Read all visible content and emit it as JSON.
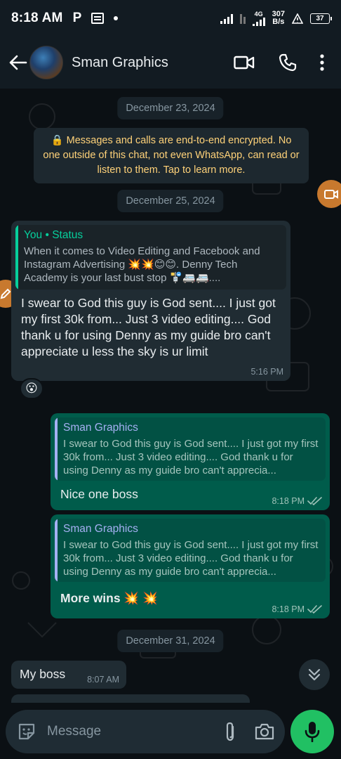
{
  "status_bar": {
    "time": "8:18 AM",
    "net_speed_value": "307",
    "net_speed_unit": "B/s",
    "network_type": "4G",
    "battery": "37"
  },
  "header": {
    "contact_name": "Sman Graphics",
    "icons": [
      "back-arrow-icon",
      "video-call-icon",
      "phone-icon",
      "more-vert-icon"
    ]
  },
  "chat": {
    "dates": {
      "d1": "December 23, 2024",
      "d2": "December 25, 2024",
      "d3": "December 31, 2024"
    },
    "encryption_notice": "🔒 Messages and calls are end-to-end encrypted. No one outside of this chat, not even WhatsApp, can read or listen to them. Tap to learn more.",
    "messages": [
      {
        "direction": "in",
        "quote_author": "You • Status",
        "quote_text": "When it comes to Video Editing and Facebook and Instagram Advertising 💥💥😊😊. Denny Tech Academy is your last bust stop 🚏🚐🚐....",
        "text": "I swear to God this guy is God sent.... I just got my first 30k from... Just 3 video editing.... God thank u for using Denny as my guide bro can't appreciate u less the sky is ur limit",
        "time": "5:16 PM",
        "reaction": "😮"
      },
      {
        "direction": "out",
        "quote_author": "Sman Graphics",
        "quote_text": "I swear to God this guy is God sent.... I just got my first 30k from... Just 3 video editing....  God thank u for using Denny as my guide bro can't apprecia...",
        "text": "Nice one boss",
        "time": "8:18 PM"
      },
      {
        "direction": "out",
        "quote_author": "Sman Graphics",
        "quote_text": "I swear to God this guy is God sent.... I just got my first 30k from... Just 3 video editing....  God thank u for using Denny as my guide bro can't apprecia...",
        "text": "More wins 💥 💥",
        "time": "8:18 PM"
      },
      {
        "direction": "in",
        "text": "My boss",
        "time": "8:07 AM"
      }
    ]
  },
  "composer": {
    "placeholder": "Message"
  },
  "colors": {
    "outgoing_bubble": "#005c4b",
    "incoming_bubble": "#202c33",
    "accent_green": "#21c063",
    "encryption_text": "#ffd279"
  }
}
